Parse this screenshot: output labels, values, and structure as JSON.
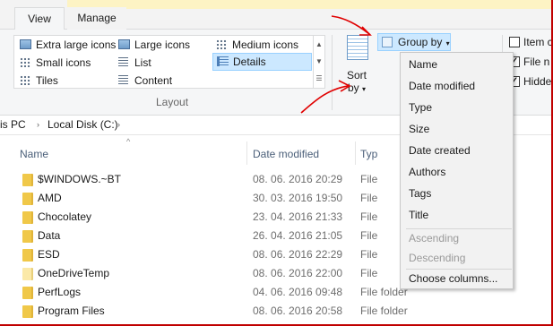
{
  "tabs": {
    "view": "View",
    "manage": "Manage"
  },
  "layout": {
    "items": [
      {
        "label": "Extra large icons",
        "icon": "extra-large-icons-icon"
      },
      {
        "label": "Large icons",
        "icon": "large-icons-icon"
      },
      {
        "label": "Medium icons",
        "icon": "medium-icons-icon"
      },
      {
        "label": "Small icons",
        "icon": "small-icons-icon"
      },
      {
        "label": "List",
        "icon": "list-icon"
      },
      {
        "label": "Details",
        "icon": "details-icon",
        "selected": true
      },
      {
        "label": "Tiles",
        "icon": "tiles-icon"
      },
      {
        "label": "Content",
        "icon": "content-icon"
      }
    ],
    "group_label": "Layout"
  },
  "sort": {
    "label_line1": "Sort",
    "label_line2": "by"
  },
  "groupby": {
    "label": "Group by"
  },
  "show_hide": [
    {
      "label": "Item c",
      "checked": false
    },
    {
      "label": "File n",
      "checked": true
    },
    {
      "label": "Hidde",
      "checked": true
    }
  ],
  "address": {
    "segment1": "is PC",
    "segment2": "Local Disk (C:)"
  },
  "columns": {
    "name": "Name",
    "date": "Date modified",
    "type": "Typ"
  },
  "files": [
    {
      "name": "$WINDOWS.~BT",
      "date": "08. 06. 2016 20:29",
      "type": "File"
    },
    {
      "name": "AMD",
      "date": "30. 03. 2016 19:50",
      "type": "File"
    },
    {
      "name": "Chocolatey",
      "date": "23. 04. 2016 21:33",
      "type": "File"
    },
    {
      "name": "Data",
      "date": "26. 04. 2016 21:05",
      "type": "File"
    },
    {
      "name": "ESD",
      "date": "08. 06. 2016 22:29",
      "type": "File"
    },
    {
      "name": "OneDriveTemp",
      "date": "08. 06. 2016 22:00",
      "type": "File"
    },
    {
      "name": "PerfLogs",
      "date": "04. 06. 2016 09:48",
      "type": "File folder"
    },
    {
      "name": "Program Files",
      "date": "08. 06. 2016 20:58",
      "type": "File folder"
    }
  ],
  "menu": {
    "items": [
      "Name",
      "Date modified",
      "Type",
      "Size",
      "Date created",
      "Authors",
      "Tags",
      "Title"
    ],
    "order": [
      "Ascending",
      "Descending"
    ],
    "choose": "Choose columns..."
  },
  "colors": {
    "accent": "#cce8ff",
    "annotation": "#e00000",
    "folder": "#f0c849"
  }
}
